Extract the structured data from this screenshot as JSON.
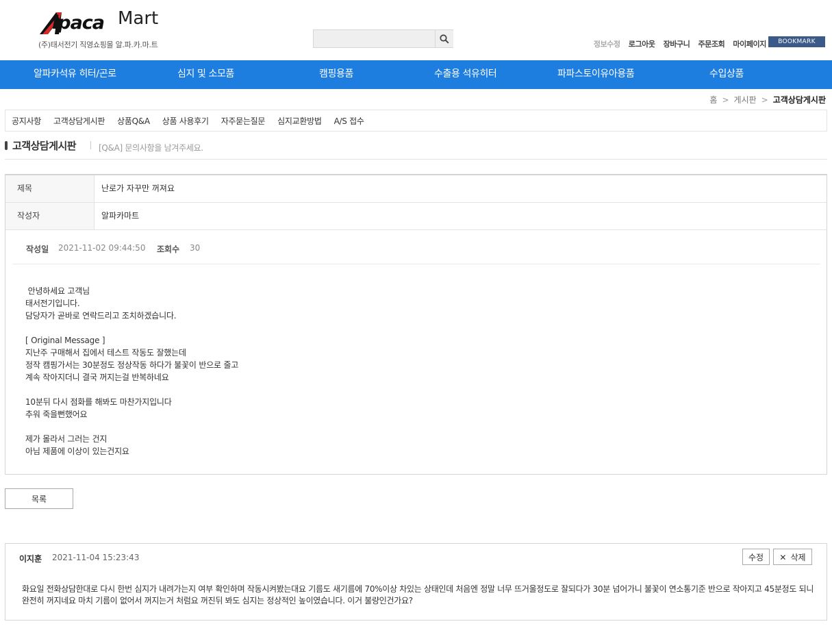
{
  "header": {
    "logo_main": "lpaca",
    "logo_sub": "Mart",
    "tagline": "(주)태서전기 직영쇼핑몰 알.파.카.마.트",
    "search_placeholder": "",
    "toplinks": [
      "정보수정",
      "로그아웃",
      "장바구니",
      "주문조회",
      "마이페이지"
    ],
    "bookmark": "BOOKMARK"
  },
  "gnb": [
    "알파카석유 히터/곤로",
    "심지 및 소모품",
    "캠핑용품",
    "수출용 석유히터",
    "파파스토이유아용품",
    "수입상품"
  ],
  "breadcrumb": {
    "home": "홈",
    "board": "게시판",
    "current": "고객상담게시판"
  },
  "subnav": [
    "공지사항",
    "고객상담게시판",
    "상품Q&A",
    "상품 사용후기",
    "자주묻는질문",
    "심지교환방법",
    "A/S 접수"
  ],
  "board": {
    "title": "고객상담게시판",
    "desc": "[Q&A] 문의사항을 남겨주세요."
  },
  "post": {
    "subject_label": "제목",
    "subject": "난로가 자꾸만 꺼져요",
    "author_label": "작성자",
    "author": "알파카마트",
    "date_label": "작성일",
    "date": "2021-11-02 09:44:50",
    "views_label": "조회수",
    "views": "30",
    "content": " 안녕하세요 고객님\n태서전기입니다.\n담당자가 곧바로 연락드리고 조치하겠습니다.\n\n[ Original Message ]\n지난주 구매해서 집에서 테스트 작동도 잘했는데\n정작 캠핑가서는 30분정도 정상작동 하다가 불꽃이 반으로 줄고\n계속 작아지더니 결국 꺼지는걸 반복하네요\n\n10분뒤 다시 점화를 해봐도 마찬가지입니다\n추워 죽을뻔했어요\n\n제가 몰라서 그러는 건지\n아님 제품에 이상이 있는건지요"
  },
  "buttons": {
    "list": "목록",
    "edit": "수정",
    "delete": "삭제"
  },
  "comment": {
    "author": "이지훈",
    "date": "2021-11-04 15:23:43",
    "body": "화요일 전화상담한대로 다시 한번 심지가 내려가는지 여부 확인하며 작동시켜봤는대요 기름도 새기름에 70%이상 차있는 상태인데 처음엔 정말 너무 뜨거울정도로 잘되다가 30분 넘어가니 불꽃이 연소통기준 반으로 작아지고 45분정도 되니 완전히 꺼지네요 마치 기름이 없어서 꺼지는거 처럼요 꺼진뒤 봐도 심지는 정상적인 높이였습니다. 이거 불량인건가요?"
  },
  "colors": {
    "gnb": "#1d7ee0",
    "bookmark": "#3b5a8a"
  }
}
